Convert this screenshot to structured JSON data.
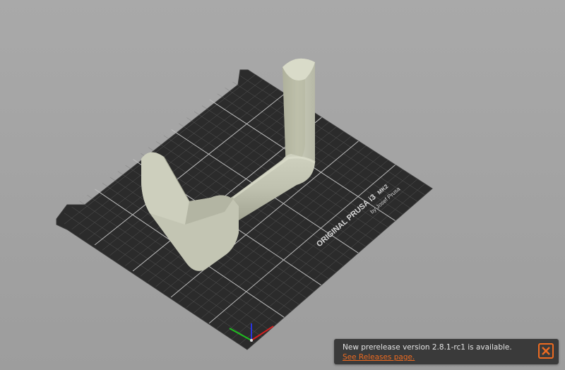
{
  "bed": {
    "brand_line": "ORIGINAL PRUSA i3",
    "brand_model": "MK2",
    "brand_author": "by Josef Prusa"
  },
  "notification": {
    "message": "New prerelease version 2.8.1-rc1 is available.",
    "link_label": "See Releases page.",
    "close_icon": "close-icon"
  },
  "colors": {
    "accent": "#ed6b21",
    "bed": "#2c2c2c",
    "model": "#c4c6b4",
    "background": "#a4a4a4"
  }
}
